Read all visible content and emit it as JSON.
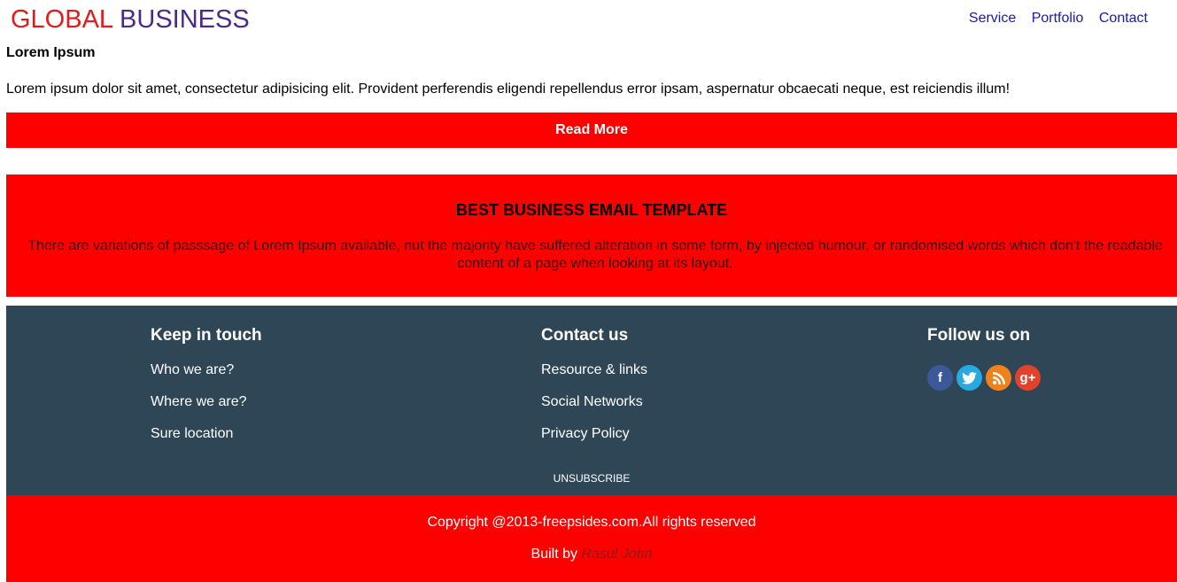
{
  "header": {
    "logo_part1": "GLOBAL",
    "logo_part2": "BUSINESS",
    "nav": [
      "Service",
      "Portfolio",
      "Contact"
    ]
  },
  "intro": {
    "title": "Lorem Ipsum",
    "text": "Lorem ipsum dolor sit amet, consectetur adipisicing elit. Provident perferendis eligendi repellendus error ipsam, aspernatur obcaecati neque, est reiciendis illum!",
    "button": "Read More"
  },
  "banner": {
    "title": "BEST BUSINESS EMAIL TEMPLATE",
    "text": "There are variations of passsage of Lorem Ipsum available, nut the majority have suffered alteration in some form, by injected humour, or randomised words which don't the readable content of a page when looking at its layout."
  },
  "footer": {
    "col1": {
      "title": "Keep in touch",
      "items": [
        "Who we are?",
        "Where we are?",
        "Sure location"
      ]
    },
    "col2": {
      "title": "Contact us",
      "items": [
        "Resource & links",
        "Social Networks",
        "Privacy Policy"
      ]
    },
    "col3": {
      "title": "Follow us on",
      "icons": [
        "facebook-icon",
        "twitter-icon",
        "rss-icon",
        "google-plus-icon"
      ]
    },
    "unsubscribe": "UNSUBSCRIBE"
  },
  "bottom": {
    "copyright": "Copyright @2013-freepsides.com.All rights reserved",
    "built_by": "Built by",
    "author": "Rasul John"
  },
  "colors": {
    "accent": "#ff0000",
    "footer_bg": "#2e4655",
    "logo_red": "#e21b1b",
    "logo_purple": "#4a2a8c",
    "nav_link": "#1a1aa6"
  }
}
